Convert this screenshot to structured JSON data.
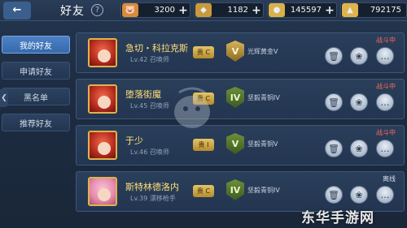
{
  "header": {
    "back_icon": "back-arrow-icon",
    "title": "好友",
    "help_label": "?"
  },
  "currencies": [
    {
      "icon": "pig-coin-icon",
      "value": "3200",
      "color": "#d98b3a"
    },
    {
      "icon": "gold-bag-icon",
      "value": "1182",
      "color": "#c99a3c"
    },
    {
      "icon": "coin-stack-icon",
      "value": "145597",
      "color": "#d7b24a"
    },
    {
      "icon": "gem-bag-icon",
      "value": "792175",
      "color": "#e0b44c"
    }
  ],
  "tabs": [
    {
      "label": "我的好友",
      "active": true
    },
    {
      "label": "申请好友",
      "active": false
    },
    {
      "label": "黑名单",
      "active": false
    },
    {
      "label": "推荐好友",
      "active": false
    }
  ],
  "friends": [
    {
      "name": "急切・科拉克斯",
      "meta": "Lv.42 召唤师",
      "vip": "贵 C",
      "rank_letter": "V",
      "rank_name": "光辉黄金V",
      "status": "战斗中"
    },
    {
      "name": "堕落街魔",
      "meta": "Lv.45 召唤师",
      "vip": "贵 C",
      "rank_letter": "IV",
      "rank_name": "坚毅青铜IV",
      "status": "战斗中"
    },
    {
      "name": "于少",
      "meta": "Lv.46 召唤师",
      "vip": "贵 I",
      "rank_letter": "V",
      "rank_name": "坚毅青铜V",
      "status": "战斗中"
    },
    {
      "name": "斯特林德洛内",
      "meta": "Lv.39 漂移枪手",
      "vip": "贵 C",
      "rank_letter": "IV",
      "rank_name": "坚毅青铜IV",
      "status": "离线"
    }
  ],
  "watermark": "东华手游网"
}
